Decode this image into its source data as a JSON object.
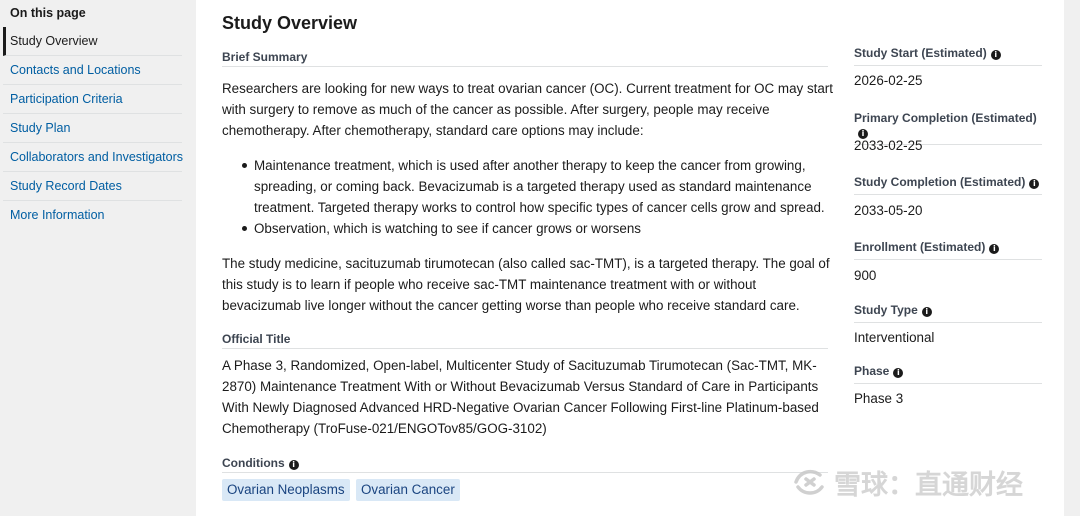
{
  "toc": {
    "heading": "On this page",
    "items": [
      {
        "label": "Study Overview"
      },
      {
        "label": "Contacts and Locations"
      },
      {
        "label": "Participation Criteria"
      },
      {
        "label": "Study Plan"
      },
      {
        "label": "Collaborators and Investigators"
      },
      {
        "label": "Study Record Dates"
      },
      {
        "label": "More Information"
      }
    ]
  },
  "overview": {
    "title": "Study Overview",
    "brief_summary_label": "Brief Summary",
    "summary_intro": "Researchers are looking for new ways to treat ovarian cancer (OC). Current treatment for OC may start with surgery to remove as much of the cancer as possible. After surgery, people may receive chemotherapy. After chemotherapy, standard care options may include:",
    "bullets": [
      "Maintenance treatment, which is used after another therapy to keep the cancer from growing, spreading, or coming back. Bevacizumab is a targeted therapy used as standard maintenance treatment. Targeted therapy works to control how specific types of cancer cells grow and spread.",
      "Observation, which is watching to see if cancer grows or worsens"
    ],
    "summary_outro": "The study medicine, sacituzumab tirumotecan (also called sac-TMT), is a targeted therapy. The goal of this study is to learn if people who receive sac-TMT maintenance treatment with or without bevacizumab live longer without the cancer getting worse than people who receive standard care.",
    "official_title_label": "Official Title",
    "official_title": "A Phase 3, Randomized, Open-label, Multicenter Study of Sacituzumab Tirumotecan (Sac-TMT, MK-2870) Maintenance Treatment With or Without Bevacizumab Versus Standard of Care in Participants With Newly Diagnosed Advanced HRD-Negative Ovarian Cancer Following First-line Platinum-based Chemotherapy (TroFuse-021/ENGOTov85/GOG-3102)",
    "conditions_label": "Conditions",
    "conditions": [
      "Ovarian Neoplasms",
      "Ovarian Cancer"
    ]
  },
  "facts": [
    {
      "label": "Study Start (Estimated)",
      "value": "2026-02-25",
      "info": true
    },
    {
      "label": "Primary Completion (Estimated)",
      "value": "2033-02-25",
      "info": true
    },
    {
      "label": "Study Completion (Estimated)",
      "value": "2033-05-20",
      "info": true
    },
    {
      "label": "Enrollment (Estimated)",
      "value": "900",
      "info": true
    },
    {
      "label": "Study Type",
      "value": "Interventional",
      "info": true
    },
    {
      "label": "Phase",
      "value": "Phase 3",
      "info": true
    }
  ],
  "info_glyph": "i",
  "watermark": {
    "text": "雪球：直通财经"
  },
  "colors": {
    "link": "#005ea2",
    "tag_bg": "#d9e8f6",
    "tag_text": "#1a4480"
  }
}
